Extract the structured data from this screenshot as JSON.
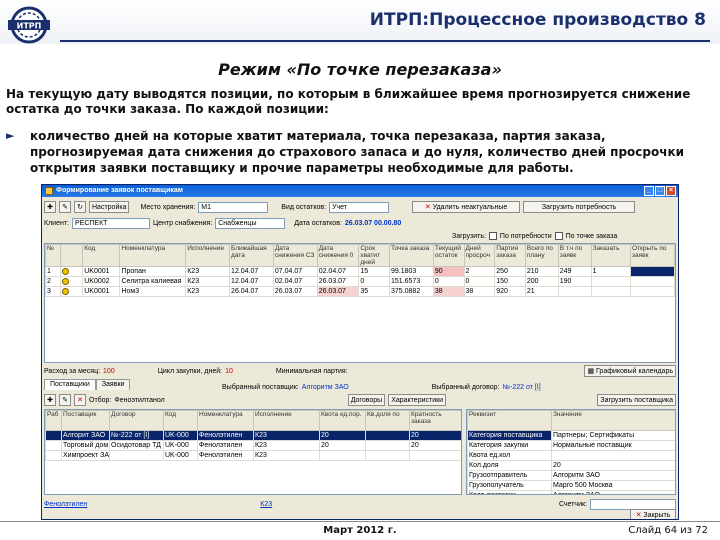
{
  "slide": {
    "logo_text": "ИТРП",
    "title": "ИТРП:Процессное производство 8",
    "subtitle": "Режим «По точке перезаказа»",
    "intro": "На текущую дату выводятся позиции, по которым в ближайшее время прогнозируется снижение остатка до точки заказа. По каждой позиции:",
    "bullet": "количество дней на которые хватит материала, точка перезаказа, партия заказа, прогнозируемая дата снижения до страхового запаса и до нуля, количество дней просрочки открытия заявки поставщику и прочие параметры необходимые для работы.",
    "footer_date": "Март 2012 г.",
    "footer_slide": "Слайд 64 из 72"
  },
  "window": {
    "title": "Формирование заявок поставщикам",
    "toolbar": {
      "settings_label": "Настройка",
      "storage_label": "Место хранения:",
      "storage_value": "М1",
      "calc_label": "Вид остатков:",
      "calc_value": "Учет",
      "delete_label": "Удалить неактуальные",
      "load_label": "Загрузить потребность"
    },
    "row2": {
      "client_label": "Клиент:",
      "client_value": "РЕСПЕКТ",
      "center_label": "Центр снабжения:",
      "center_value": "Снабженцы",
      "date_label": "Дата остатков:",
      "date_value": "26.03.07 00.00.80",
      "load_label": "Загрузить:",
      "need_label": "По потребности",
      "point_label": "По точке заказа"
    },
    "grid": {
      "headers": [
        "№",
        "",
        "Код",
        "Номенклатура",
        "Исполнение",
        "Ближайшая дата",
        "Дата снижения СЗ",
        "Дата снижения 0",
        "Срок хватит дней",
        "Точка заказа",
        "Текущий остаток",
        "Дней просроч",
        "Партия заказа",
        "Всего по плану",
        "В т.ч по заявк",
        "Заказать",
        "Открыть по заявк"
      ],
      "rows": [
        [
          "1",
          "",
          "UK0001",
          "Пропан",
          "К23",
          "12.04.07",
          "07.04.07",
          "02.04.07",
          "15",
          "99.1803",
          "90",
          "2",
          "250",
          "210",
          "249",
          "1",
          ""
        ],
        [
          "2",
          "",
          "UK0002",
          "Селитра калиевая",
          "К23",
          "12.04.07",
          "02.04.07",
          "26.03.07",
          "0",
          "151.6573",
          "0",
          "0",
          "150",
          "200",
          "190",
          "",
          ""
        ],
        [
          "3",
          "",
          "UK0001",
          "Ном3",
          "К23",
          "26.04.07",
          "26.03.07",
          "26.03.07",
          "35",
          "375.0882",
          "38",
          "38",
          "920",
          "21",
          "",
          "",
          ""
        ]
      ]
    },
    "info": {
      "daily_label": "Расход за месяц:",
      "daily_value": "100",
      "cycle_label": "Цикл закупки, дней:",
      "cycle_value": "10",
      "transport_label": "Минимальная партия:",
      "calendar_label": "Графиковый календарь"
    },
    "tabs": [
      "Поставщики",
      "Заявки"
    ],
    "supplier_row": {
      "selected_label": "Выбранный поставщик:",
      "selected_value": "Алгоритм ЗАО",
      "contract_label": "Выбранный договор:",
      "contract_value": "№-222 от [I]"
    },
    "supplier_toolbar": {
      "filter_label": "Отбор:",
      "filter_value": "Феноэтилтанол",
      "contracts_label": "Договоры",
      "chars_label": "Характеристики",
      "load_supp_label": "Загрузить поставщика"
    },
    "suppliers": {
      "headers": [
        "Раб",
        "Поставщик",
        "Договор",
        "Код",
        "Номенклатура",
        "Исполнение",
        "Квота ед.пор.",
        "Кв.доля по",
        "Кратность заказа"
      ],
      "rows": [
        [
          "",
          "Алгорит ЗАО",
          "№-222 от [I]",
          "UK-000",
          "Фенолэтилен",
          "К23",
          "20",
          "",
          "20"
        ],
        [
          "",
          "Торговый дом...",
          "Осидотовар ТД",
          "UK-000",
          "Фенолэтилен",
          "К23",
          "20",
          "",
          "20"
        ],
        [
          "",
          "Химпроект ЗАО",
          "",
          "UK-000",
          "Фенолэтилен",
          "К23",
          "",
          "",
          ""
        ]
      ]
    },
    "props": {
      "headers": [
        "Реквизит",
        "Значение"
      ],
      "rows": [
        [
          "Категория поставщика",
          "Партнеры; Сертификаты"
        ],
        [
          "Категория закупки",
          "Нормальные поставщик"
        ],
        [
          "Квота ед.кол",
          ""
        ],
        [
          "Кол.доля",
          "20"
        ],
        [
          "Грузоотправитель",
          "Алгоритм ЗАО"
        ],
        [
          "Грузополучатель",
          "Марго 500 Москва"
        ],
        [
          "Крат. поставки",
          "Алгоритм ЗАО"
        ]
      ]
    },
    "bottom": {
      "item_value": "Фенолэтилен",
      "exec_value": "К23",
      "count_label": "Счетчик:",
      "close_label": "Закрыть"
    }
  }
}
